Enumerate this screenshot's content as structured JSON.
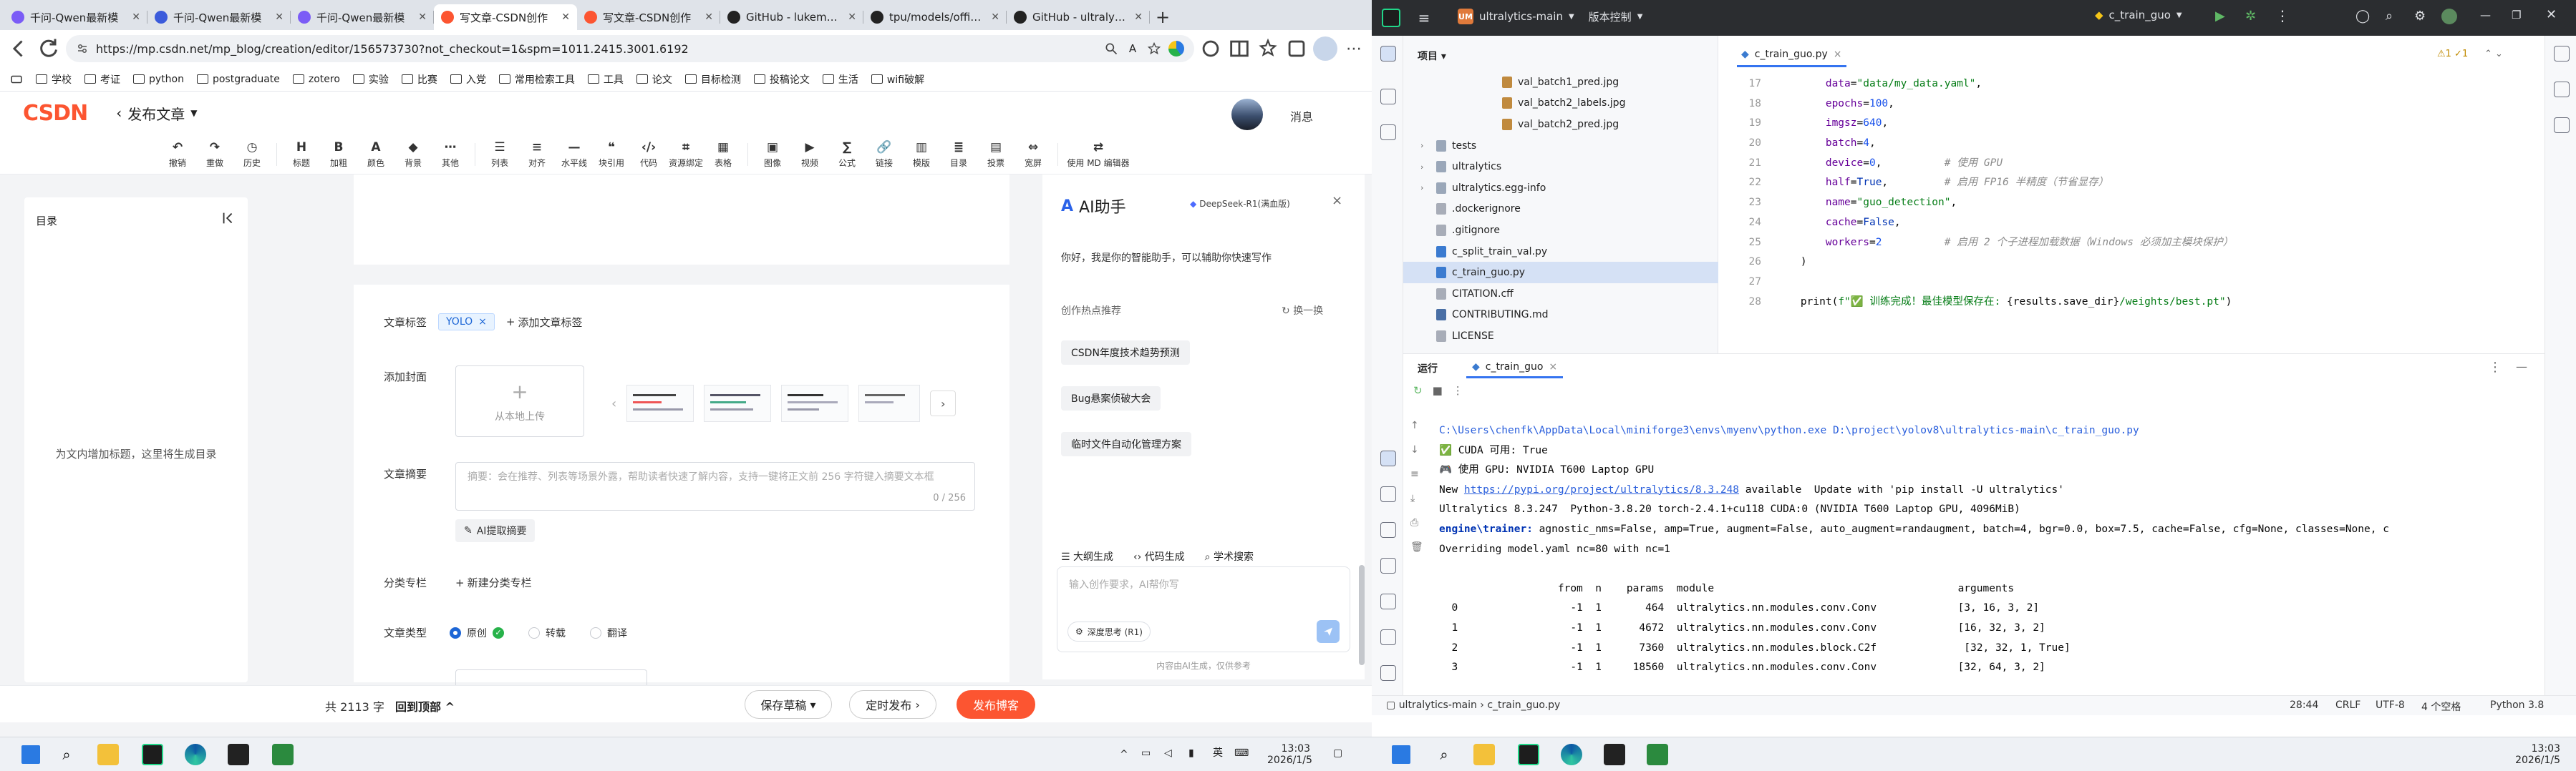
{
  "browser": {
    "tabs": [
      {
        "title": "千问-Qwen最新模",
        "color": "#7b5cf6",
        "active": false
      },
      {
        "title": "千问-Qwen最新模",
        "color": "#3b5bdb",
        "active": false
      },
      {
        "title": "千问-Qwen最新模",
        "color": "#7b5cf6",
        "active": false
      },
      {
        "title": "写文章-CSDN创作",
        "color": "#fc5531",
        "active": true
      },
      {
        "title": "写文章-CSDN创作",
        "color": "#fc5531",
        "active": false
      },
      {
        "title": "GitHub - lukemela",
        "color": "#222222",
        "active": false
      },
      {
        "title": "tpu/models/officia",
        "color": "#222222",
        "active": false
      },
      {
        "title": "GitHub - ultralytics",
        "color": "#222222",
        "active": false
      }
    ],
    "url": "https://mp.csdn.net/mp_blog/creation/editor/156573730?not_checkout=1&spm=1011.2415.3001.6192",
    "bookmarks": [
      "学校",
      "考证",
      "python",
      "postgraduate",
      "zotero",
      "实验",
      "比赛",
      "入党",
      "常用检索工具",
      "工具",
      "论文",
      "目标检测",
      "投稿论文",
      "生活",
      "wifi破解"
    ]
  },
  "csdn": {
    "logo": "CSDN",
    "page_title": "发布文章",
    "msg": "消息",
    "toolbar": [
      "撤销",
      "重做",
      "历史",
      "|",
      "标题",
      "加粗",
      "颜色",
      "背景",
      "其他",
      "|",
      "列表",
      "对齐",
      "水平线",
      "块引用",
      "代码",
      "资源绑定",
      "表格",
      "|",
      "图像",
      "视频",
      "公式",
      "链接",
      "模版",
      "目录",
      "投票",
      "宽屏",
      "|",
      "使用 MD 编辑器"
    ],
    "toc_title": "目录",
    "toc_hint": "为文内增加标题，这里将生成目录",
    "labels": {
      "tags": "文章标签",
      "cover": "添加封面",
      "abstract": "文章摘要",
      "category": "分类专栏",
      "type": "文章类型"
    },
    "tag_chip": "YOLO",
    "add_tag": "添加文章标签",
    "upload": "从本地上传",
    "abstract_placeholder": "摘要：会在推荐、列表等场景外露，帮助读者快速了解内容，支持一键将正文前 256 字符键入摘要文本框",
    "abstract_count": "0 / 256",
    "ai_extract": "AI提取摘要",
    "new_category": "新建分类专栏",
    "types": [
      "原创",
      "转载",
      "翻译"
    ],
    "word_count": "共 2113 字",
    "back_top": "回到顶部",
    "save_draft": "保存草稿",
    "scheduled": "定时发布",
    "publish": "发布博客"
  },
  "ai": {
    "title": "AI助手",
    "model": "DeepSeek-R1(满血版)",
    "hello": "你好，我是你的智能助手，可以辅助你快速写作",
    "rec_title": "创作热点推荐",
    "swap": "换一换",
    "pills": [
      "CSDN年度技术趋势预测",
      "Bug悬案侦破大会",
      "临时文件自动化管理方案"
    ],
    "modes": [
      "大纲生成",
      "代码生成",
      "学术搜索"
    ],
    "placeholder": "输入创作要求，AI帮你写",
    "think": "深度思考 (R1)",
    "footer": "内容由AI生成，仅供参考"
  },
  "taskbar_left": {
    "time": "13:03",
    "date": "2026/1/5",
    "ime": "英"
  },
  "ide": {
    "project": "ultralytics-main",
    "vcs": "版本控制",
    "run_config": "c_train_guo",
    "panel_title": "项目",
    "tree": [
      {
        "name": "val_batch1_pred.jpg",
        "kind": "img",
        "indent": 3
      },
      {
        "name": "val_batch2_labels.jpg",
        "kind": "img",
        "indent": 3
      },
      {
        "name": "val_batch2_pred.jpg",
        "kind": "img",
        "indent": 3
      },
      {
        "name": "tests",
        "kind": "dir",
        "indent": 1
      },
      {
        "name": "ultralytics",
        "kind": "dir",
        "indent": 1
      },
      {
        "name": "ultralytics.egg-info",
        "kind": "dir",
        "indent": 1
      },
      {
        "name": ".dockerignore",
        "kind": "file",
        "indent": 1
      },
      {
        "name": ".gitignore",
        "kind": "file",
        "indent": 1
      },
      {
        "name": "c_split_train_val.py",
        "kind": "py",
        "indent": 1
      },
      {
        "name": "c_train_guo.py",
        "kind": "py",
        "indent": 1,
        "selected": true
      },
      {
        "name": "CITATION.cff",
        "kind": "file",
        "indent": 1
      },
      {
        "name": "CONTRIBUTING.md",
        "kind": "md",
        "indent": 1
      },
      {
        "name": "LICENSE",
        "kind": "file",
        "indent": 1
      }
    ],
    "file_tab": "c_train_guo.py",
    "inspections": "⚠1 ✓1",
    "code": [
      {
        "n": "17",
        "html": "        <span class=\"par\">data</span>=<span class=\"str\">\"data/my_data.yaml\"</span>,"
      },
      {
        "n": "18",
        "html": "        <span class=\"par\">epochs</span>=<span class=\"num\">100</span>,"
      },
      {
        "n": "19",
        "html": "        <span class=\"par\">imgsz</span>=<span class=\"num\">640</span>,"
      },
      {
        "n": "20",
        "html": "        <span class=\"par\">batch</span>=<span class=\"num\">4</span>,"
      },
      {
        "n": "21",
        "html": "        <span class=\"par\">device</span>=<span class=\"num\">0</span>,          <span class=\"cmt\"># 使用 GPU</span>"
      },
      {
        "n": "22",
        "html": "        <span class=\"par\">half</span>=<span class=\"kw\">True</span>,         <span class=\"cmt\"># 启用 FP16 半精度（节省显存）</span>"
      },
      {
        "n": "23",
        "html": "        <span class=\"par\">name</span>=<span class=\"str\">\"guo_detection\"</span>,"
      },
      {
        "n": "24",
        "html": "        <span class=\"par\">cache</span>=<span class=\"kw\">False</span>,"
      },
      {
        "n": "25",
        "html": "        <span class=\"par\">workers</span>=<span class=\"num\">2</span>          <span class=\"cmt\"># 启用 2 个子进程加载数据（Windows 必须加主模块保护）</span>"
      },
      {
        "n": "26",
        "html": "    )"
      },
      {
        "n": "27",
        "html": ""
      },
      {
        "n": "28",
        "html": "    print(<span class=\"str\">f\"✅ 训练完成！最佳模型保存在: </span>{results.save_dir}<span class=\"str\">/weights/best.pt\"</span>)"
      }
    ],
    "run_title": "运行",
    "run_tab": "c_train_guo",
    "console": [
      "C:\\Users\\chenfk\\AppData\\Local\\miniforge3\\envs\\myenv\\python.exe D:\\project\\yolov8\\ultralytics-main\\c_train_guo.py",
      "✅ CUDA 可用: True",
      "🎮 使用 GPU: NVIDIA T600 Laptop GPU",
      "New https://pypi.org/project/ultralytics/8.3.248 available  Update with 'pip install -U ultralytics'",
      "Ultralytics 8.3.247  Python-3.8.20 torch-2.4.1+cu118 CUDA:0 (NVIDIA T600 Laptop GPU, 4096MiB)",
      "engine\\trainer: agnostic_nms=False, amp=True, augment=False, auto_augment=randaugment, batch=4, bgr=0.0, box=7.5, cache=False, cfg=None, classes=None, c",
      "Overriding model.yaml nc=80 with nc=1",
      "",
      "                   from  n    params  module                                       arguments",
      "  0                  -1  1       464  ultralytics.nn.modules.conv.Conv             [3, 16, 3, 2]",
      "  1                  -1  1      4672  ultralytics.nn.modules.conv.Conv             [16, 32, 3, 2]",
      "  2                  -1  1      7360  ultralytics.nn.modules.block.C2f              [32, 32, 1, True]",
      "  3                  -1  1     18560  ultralytics.nn.modules.conv.Conv             [32, 64, 3, 2]"
    ],
    "status": {
      "breadcrumb": [
        "ultralytics-main",
        "c_train_guo.py"
      ],
      "pos": "28:44",
      "eol": "CRLF",
      "enc": "UTF-8",
      "indent": "4 个空格",
      "interp": "Python 3.8"
    }
  },
  "taskbar_right": {
    "time": "13:03",
    "date": "2026/1/5"
  }
}
